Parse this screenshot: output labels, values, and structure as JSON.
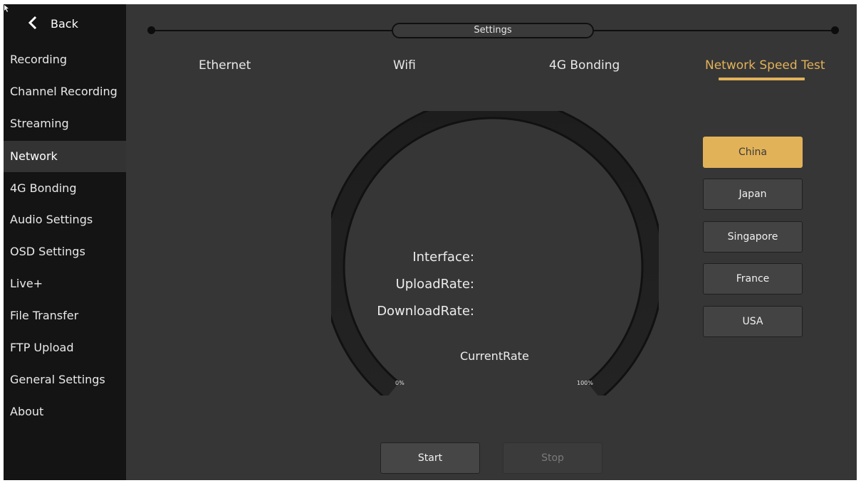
{
  "sidebar": {
    "back_label": "Back",
    "items": [
      {
        "label": "Recording"
      },
      {
        "label": "Channel Recording"
      },
      {
        "label": "Streaming"
      },
      {
        "label": "Network"
      },
      {
        "label": "4G Bonding"
      },
      {
        "label": "Audio Settings"
      },
      {
        "label": "OSD Settings"
      },
      {
        "label": "Live+"
      },
      {
        "label": "File Transfer"
      },
      {
        "label": "FTP Upload"
      },
      {
        "label": "General Settings"
      },
      {
        "label": "About"
      }
    ],
    "active": "Network"
  },
  "header": {
    "title": "Settings"
  },
  "tabs": [
    {
      "label": "Ethernet"
    },
    {
      "label": "Wifi"
    },
    {
      "label": "4G Bonding"
    },
    {
      "label": "Network Speed Test"
    }
  ],
  "active_tab": "Network Speed Test",
  "gauge": {
    "interface_label": "Interface:",
    "upload_label": "UploadRate:",
    "download_label": "DownloadRate:",
    "current_label": "CurrentRate",
    "min_label": "0%",
    "max_label": "100%"
  },
  "regions": [
    {
      "label": "China"
    },
    {
      "label": "Japan"
    },
    {
      "label": "Singapore"
    },
    {
      "label": "France"
    },
    {
      "label": "USA"
    }
  ],
  "selected_region": "China",
  "actions": {
    "start_label": "Start",
    "stop_label": "Stop"
  },
  "colors": {
    "accent": "#e2b259",
    "background": "#363636",
    "sidebar": "#141414"
  }
}
